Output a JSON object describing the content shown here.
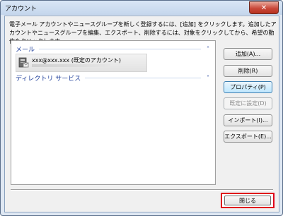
{
  "window": {
    "title": "アカウント",
    "close_glyph": "✕"
  },
  "description": "電子メール アカウントやニュースグループを新しく登録するには、[追加] をクリックします。追加したアカウントやニュースグループを編集、エクスポート、削除するには、対象をクリックしてから、希望の動作をクリックします。",
  "list": {
    "mail_group": {
      "label": "メール",
      "chevron": "˄"
    },
    "account": {
      "name": "xxx@xxx.xxx (既定のアカウント)",
      "icon": "mail-account-icon"
    },
    "directory_group": {
      "label": "ディレクトリ サービス",
      "chevron": "˅"
    }
  },
  "buttons": {
    "add": "追加(A)...",
    "delete": "削除(R)",
    "properties": "プロパティ(P)",
    "set_default": "既定に設定(D)",
    "import": "インポート(I)...",
    "export": "エクスポート(E)..."
  },
  "footer": {
    "close": "閉じる"
  },
  "colors": {
    "highlight": "#e0001a",
    "group_text": "#1e3e9a"
  }
}
